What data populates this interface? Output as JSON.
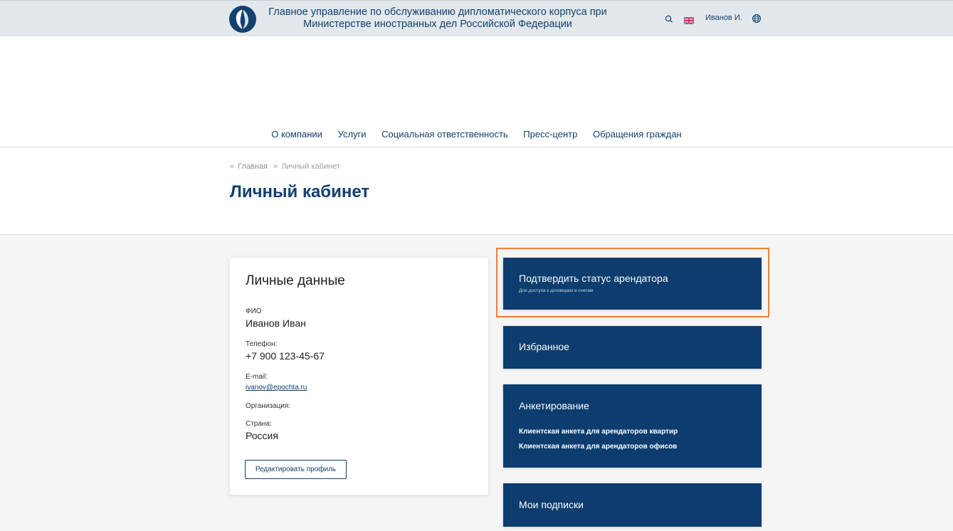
{
  "header": {
    "org_title_line1": "Главное управление по обслуживанию дипломатического корпуса при",
    "org_title_line2": "Министерстве иностранных дел Российской Федерации",
    "user_name": "Иванов И.",
    "icons": [
      "search-icon",
      "uk-flag-icon",
      "globe-icon"
    ]
  },
  "nav": {
    "items": [
      "О компании",
      "Услуги",
      "Социальная ответственность",
      "Пресс-центр",
      "Обращения граждан"
    ]
  },
  "breadcrumb": {
    "separator": "»",
    "items": [
      "Главная",
      "Личный кабинет"
    ]
  },
  "page_title": "Личный кабинет",
  "personal": {
    "title": "Личные данные",
    "fio_label": "ФИО",
    "fio_value": "Иванов Иван",
    "phone_label": "Телефон:",
    "phone_value": "+7 900 123-45-67",
    "email_label": "E-mail:",
    "email_value": "ivanov@epochta.ru",
    "org_label": "Организация:",
    "country_label": "Страна:",
    "country_value": "Россия",
    "edit_button": "Редактировать профиль"
  },
  "tiles": {
    "confirm_title": "Подтвердить статус арендатора",
    "confirm_subtitle": "Для доступа к договорам и счетам",
    "favorites_title": "Избранное",
    "survey_title": "Анкетирование",
    "survey_link_1": "Клиентская анкета для арендаторов квартир",
    "survey_link_2": "Клиентская анкета для арендаторов офисов",
    "subscriptions_title": "Мои подписки"
  },
  "colors": {
    "brand_blue": "#12406f",
    "tile_blue": "#0c3d6e",
    "highlight_orange": "#ef7f3a",
    "topbar_bg": "#e3e8ec",
    "content_bg": "#f5f5f5"
  }
}
